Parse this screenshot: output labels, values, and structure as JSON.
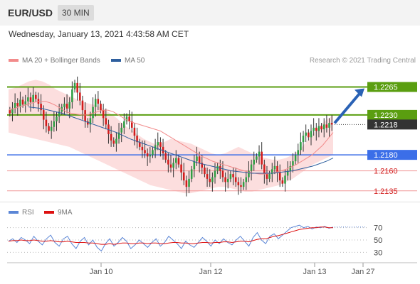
{
  "header": {
    "pair": "EUR/USD",
    "timeframe": "30 MIN"
  },
  "datetime": "Wednesday, January 13, 2021 4:43:58 AM CET",
  "legend": {
    "ma20": {
      "label": "MA 20 + Bollinger Bands",
      "color": "#f28b8b"
    },
    "ma50": {
      "label": "MA 50",
      "color": "#2e5f9e"
    }
  },
  "copyright": "Research © 2021 Trading Central",
  "rsi_legend": {
    "rsi": {
      "label": "RSI",
      "color": "#5b86d6"
    },
    "ma9": {
      "label": "9MA",
      "color": "#d11"
    }
  },
  "colors": {
    "up": "#2f9e44",
    "down": "#d21b1b",
    "resistance": "#5a9e10",
    "support": "#3b6ee8",
    "target_arrow": "#2a62b5"
  },
  "chart_data": [
    {
      "type": "candlestick",
      "series_names": [
        "MA 20 + Bollinger Bands",
        "MA 50"
      ],
      "x_ticks": [
        "Jan 10",
        "Jan 12",
        "Jan 13",
        "Jan 27"
      ],
      "ylim": [
        1.2125,
        1.2285
      ],
      "levels": [
        {
          "label": "1.2265",
          "value": 1.2265,
          "kind": "resistance"
        },
        {
          "label": "1.2230",
          "value": 1.223,
          "kind": "resistance"
        },
        {
          "label": "1.2218",
          "value": 1.2218,
          "kind": "last"
        },
        {
          "label": "1.2180",
          "value": 1.218,
          "kind": "support"
        },
        {
          "label": "1.2160",
          "value": 1.216,
          "kind": "minor"
        },
        {
          "label": "1.2135",
          "value": 1.2135,
          "kind": "minor"
        }
      ],
      "close": [
        1.2232,
        1.2238,
        1.2245,
        1.2241,
        1.2249,
        1.2243,
        1.2247,
        1.2252,
        1.2246,
        1.2255,
        1.225,
        1.2244,
        1.2236,
        1.2224,
        1.2216,
        1.221,
        1.2215,
        1.2222,
        1.2228,
        1.2234,
        1.224,
        1.2244,
        1.2238,
        1.2246,
        1.2262,
        1.227,
        1.2258,
        1.2248,
        1.2236,
        1.2222,
        1.2218,
        1.2226,
        1.224,
        1.225,
        1.2244,
        1.2236,
        1.2226,
        1.2218,
        1.2206,
        1.2198,
        1.2194,
        1.22,
        1.2208,
        1.2214,
        1.2222,
        1.2228,
        1.2222,
        1.2214,
        1.2204,
        1.2196,
        1.219,
        1.2186,
        1.2182,
        1.2178,
        1.218,
        1.2186,
        1.2192,
        1.2196,
        1.219,
        1.2182,
        1.2174,
        1.2168,
        1.2164,
        1.217,
        1.2176,
        1.2168,
        1.2158,
        1.2148,
        1.214,
        1.215,
        1.2162,
        1.2172,
        1.2178,
        1.217,
        1.2164,
        1.2156,
        1.215,
        1.2146,
        1.2152,
        1.216,
        1.2166,
        1.216,
        1.2152,
        1.2146,
        1.215,
        1.2156,
        1.2152,
        1.2146,
        1.2142,
        1.214,
        1.2146,
        1.2152,
        1.216,
        1.2168,
        1.2174,
        1.2178,
        1.2184,
        1.2168,
        1.2156,
        1.215,
        1.2156,
        1.2162,
        1.2166,
        1.2158,
        1.2148,
        1.2144,
        1.2154,
        1.216,
        1.2166,
        1.2172,
        1.218,
        1.2186,
        1.2196,
        1.2204,
        1.2208,
        1.2202,
        1.221,
        1.2214,
        1.221,
        1.2216,
        1.2212,
        1.2218,
        1.2214,
        1.222,
        1.2218
      ],
      "ma20": [
        1.2236,
        1.2238,
        1.224,
        1.2242,
        1.2244,
        1.2246,
        1.2247,
        1.2247,
        1.2245,
        1.2242,
        1.2238,
        1.2234,
        1.2232,
        1.2231,
        1.223,
        1.223,
        1.2232,
        1.2234,
        1.2236,
        1.2236,
        1.2234,
        1.223,
        1.2226,
        1.2222,
        1.222,
        1.2218,
        1.2216,
        1.2214,
        1.2212,
        1.221,
        1.2206,
        1.2202,
        1.2198,
        1.2194,
        1.219,
        1.2186,
        1.2182,
        1.2178,
        1.2175,
        1.2172,
        1.217,
        1.2168,
        1.2166,
        1.2164,
        1.2162,
        1.216,
        1.2158,
        1.2157,
        1.2156,
        1.2156,
        1.2157,
        1.2158,
        1.216,
        1.2162,
        1.2165,
        1.2168,
        1.2172,
        1.2176,
        1.218,
        1.2186,
        1.2192,
        1.22,
        1.2208
      ],
      "ma50": [
        1.224,
        1.2239,
        1.2238,
        1.2236,
        1.2234,
        1.2232,
        1.2229,
        1.2226,
        1.2223,
        1.222,
        1.2217,
        1.2214,
        1.2211,
        1.2208,
        1.2204,
        1.22,
        1.2197,
        1.2194,
        1.2191,
        1.2188,
        1.2185,
        1.2182,
        1.2179,
        1.2176,
        1.2173,
        1.217,
        1.2168,
        1.2166,
        1.2164,
        1.2162,
        1.216,
        1.2159,
        1.2158,
        1.2157,
        1.2157,
        1.2157,
        1.2157,
        1.2158,
        1.2159,
        1.216,
        1.2162,
        1.2164,
        1.2166,
        1.2169,
        1.2172,
        1.2176
      ],
      "bb_upper": [
        1.2262,
        1.2264,
        1.2268,
        1.2272,
        1.2274,
        1.2272,
        1.2268,
        1.2262,
        1.2258,
        1.2254,
        1.225,
        1.2246,
        1.2244,
        1.2242,
        1.2238,
        1.2232,
        1.2226,
        1.2218,
        1.2212,
        1.2206,
        1.22,
        1.2196,
        1.2192,
        1.2196,
        1.22,
        1.2198,
        1.2196,
        1.2194,
        1.219,
        1.2186,
        1.2182,
        1.218,
        1.2182,
        1.2186,
        1.219,
        1.2186,
        1.2182,
        1.2178,
        1.2176,
        1.2174,
        1.2174,
        1.2176,
        1.218,
        1.2186,
        1.2196,
        1.2206,
        1.2216,
        1.2224,
        1.223
      ],
      "bb_lower": [
        1.2208,
        1.2206,
        1.2204,
        1.2202,
        1.22,
        1.2198,
        1.2196,
        1.2194,
        1.2192,
        1.219,
        1.2186,
        1.2182,
        1.2178,
        1.2174,
        1.217,
        1.2166,
        1.2162,
        1.2158,
        1.2154,
        1.215,
        1.2146,
        1.2142,
        1.214,
        1.2138,
        1.2136,
        1.2134,
        1.2132,
        1.2132,
        1.2134,
        1.2136,
        1.2138,
        1.214,
        1.214,
        1.2138,
        1.2136,
        1.2134,
        1.2134,
        1.2136,
        1.2138,
        1.214,
        1.2142,
        1.2146,
        1.215,
        1.2156,
        1.2162,
        1.2168,
        1.2172,
        1.2176,
        1.218
      ]
    },
    {
      "type": "line",
      "series_names": [
        "RSI",
        "9MA"
      ],
      "y_ticks": [
        30,
        50,
        70
      ],
      "ylim": [
        20,
        80
      ],
      "rsi": [
        48,
        52,
        46,
        54,
        50,
        44,
        56,
        48,
        42,
        52,
        58,
        46,
        40,
        52,
        56,
        44,
        36,
        48,
        54,
        42,
        50,
        38,
        32,
        44,
        52,
        40,
        46,
        54,
        48,
        36,
        42,
        50,
        44,
        38,
        46,
        52,
        40,
        46,
        56,
        50,
        44,
        36,
        48,
        42,
        38,
        46,
        54,
        48,
        40,
        50,
        44,
        52,
        46,
        42,
        50,
        56,
        48,
        40,
        54,
        62,
        50,
        44,
        56,
        60,
        52,
        58,
        64,
        70,
        72,
        74,
        70,
        72,
        68,
        71,
        70,
        72,
        69,
        71
      ],
      "ma9": [
        48,
        49,
        49,
        50,
        49,
        49,
        50,
        49,
        48,
        48,
        49,
        48,
        47,
        47,
        48,
        47,
        46,
        46,
        46,
        45,
        45,
        44,
        43,
        43,
        44,
        43,
        44,
        45,
        45,
        44,
        44,
        45,
        45,
        44,
        45,
        45,
        44,
        44,
        45,
        46,
        46,
        45,
        45,
        44,
        44,
        45,
        46,
        46,
        45,
        46,
        46,
        47,
        47,
        46,
        47,
        48,
        48,
        47,
        49,
        51,
        52,
        52,
        54,
        56,
        57,
        59,
        61,
        63,
        65,
        67,
        68,
        69,
        70,
        70,
        71,
        71,
        70,
        70
      ]
    }
  ]
}
